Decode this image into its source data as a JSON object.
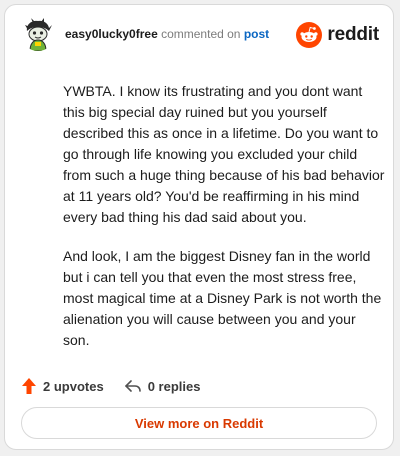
{
  "header": {
    "username": "easy0lucky0free",
    "action_text": "commented on",
    "link_text": "post",
    "brand_name": "reddit",
    "brand_color": "#ff4500"
  },
  "comment": {
    "paragraphs": [
      "YWBTA. I know its frustrating and you dont want this big special day ruined but you yourself described this as once in a lifetime. Do you want to go through life knowing you excluded your child from such a huge thing because of his bad behavior at 11 years old? You'd be reaffirming in his mind every bad thing his dad said about you.",
      "And look, I am the biggest Disney fan in the world but i can tell you that even the most stress free, most magical time at a Disney Park is not worth the alienation you will cause between you and your son."
    ]
  },
  "actions": {
    "upvote_icon": "upvote-arrow-icon",
    "upvotes_label": "2 upvotes",
    "reply_icon": "reply-arrow-icon",
    "replies_label": "0 replies"
  },
  "footer": {
    "view_more_label": "View more on Reddit",
    "accent_color": "#d93900"
  }
}
